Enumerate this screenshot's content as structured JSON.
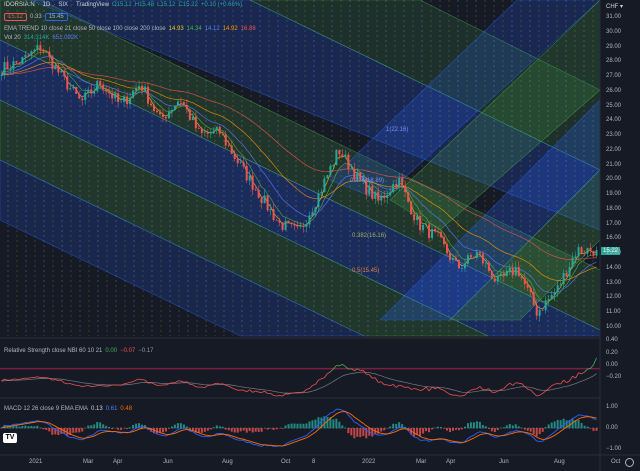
{
  "header": {
    "symbol": "IDORSIA:N",
    "interval": "1D",
    "exchange": "SIX",
    "source": "TradingView",
    "ohlc": {
      "o": "O15.12",
      "h": "H15.48",
      "l": "L15.12",
      "c": "C15.22",
      "chg": "+0.10 (+0.66%)"
    },
    "bid": "15.12",
    "spread": "0.33",
    "ask": "15.45",
    "currency": "CHF ▾"
  },
  "ema_legend": {
    "title": "EMA TREND 10 close 21 close 50 close 100 close 200 close",
    "values": [
      "14.93",
      "14.34",
      "14.12",
      "14.92",
      "16.88"
    ]
  },
  "vol_legend": {
    "title": "Vol 20",
    "values": [
      "314.314K",
      "651.092K"
    ]
  },
  "rs_legend": {
    "title": "Relative Strength close NBI 60 10 21",
    "values": [
      "0.00",
      "−0.07",
      "−0.17"
    ]
  },
  "macd_legend": {
    "title": "MACD 12 26 close 9 EMA EMA",
    "values": [
      "0.13",
      "0.61",
      "0.48"
    ]
  },
  "fib_labels": [
    "1(22.16)",
    "0.382(16.16)",
    "0.5(15.45)",
    "0.236(18.89)"
  ],
  "last_price": "15.22",
  "colors": {
    "up": "#26a69a",
    "down": "#ef5350",
    "bg": "#161a25",
    "channel_blue": "#2962ff",
    "channel_green": "#4caf50",
    "rs": "#ef5350",
    "macd": "#2962ff",
    "signal": "#ff6d00"
  },
  "chart_data": {
    "type": "candlestick",
    "title": "IDORSIA:N 1D SIX",
    "price_axis": {
      "ticks": [
        "31.00",
        "30.00",
        "29.00",
        "28.00",
        "27.00",
        "26.00",
        "25.00",
        "24.00",
        "23.00",
        "22.00",
        "21.00",
        "20.00",
        "19.00",
        "18.00",
        "17.00",
        "16.00",
        "15.00",
        "14.00",
        "13.00",
        "12.00",
        "11.00",
        "10.00"
      ],
      "range": [
        9.6,
        31.6
      ]
    },
    "rs_axis": {
      "ticks": [
        "0.40",
        "0.20",
        "0.00",
        "−0.20"
      ]
    },
    "macd_axis": {
      "ticks": [
        "1.00",
        "0.00",
        "−1.00"
      ]
    },
    "time_axis": {
      "ticks": [
        "2021",
        "Mar",
        "Apr",
        "Jun",
        "Aug",
        "Oct",
        "8",
        "2022",
        "Mar",
        "Apr",
        "Jun",
        "Aug",
        "Oct"
      ]
    },
    "close_keypoints": [
      27.5,
      28.0,
      29.0,
      27.0,
      25.2,
      26.6,
      25.0,
      26.5,
      24.0,
      25.5,
      23.0,
      23.2,
      21.0,
      19.0,
      17.0,
      16.4,
      19.0,
      22.0,
      20.0,
      18.5,
      20.0,
      17.0,
      16.0,
      14.0,
      15.0,
      13.0,
      14.0,
      11.0,
      12.5,
      15.2,
      15.22
    ]
  }
}
